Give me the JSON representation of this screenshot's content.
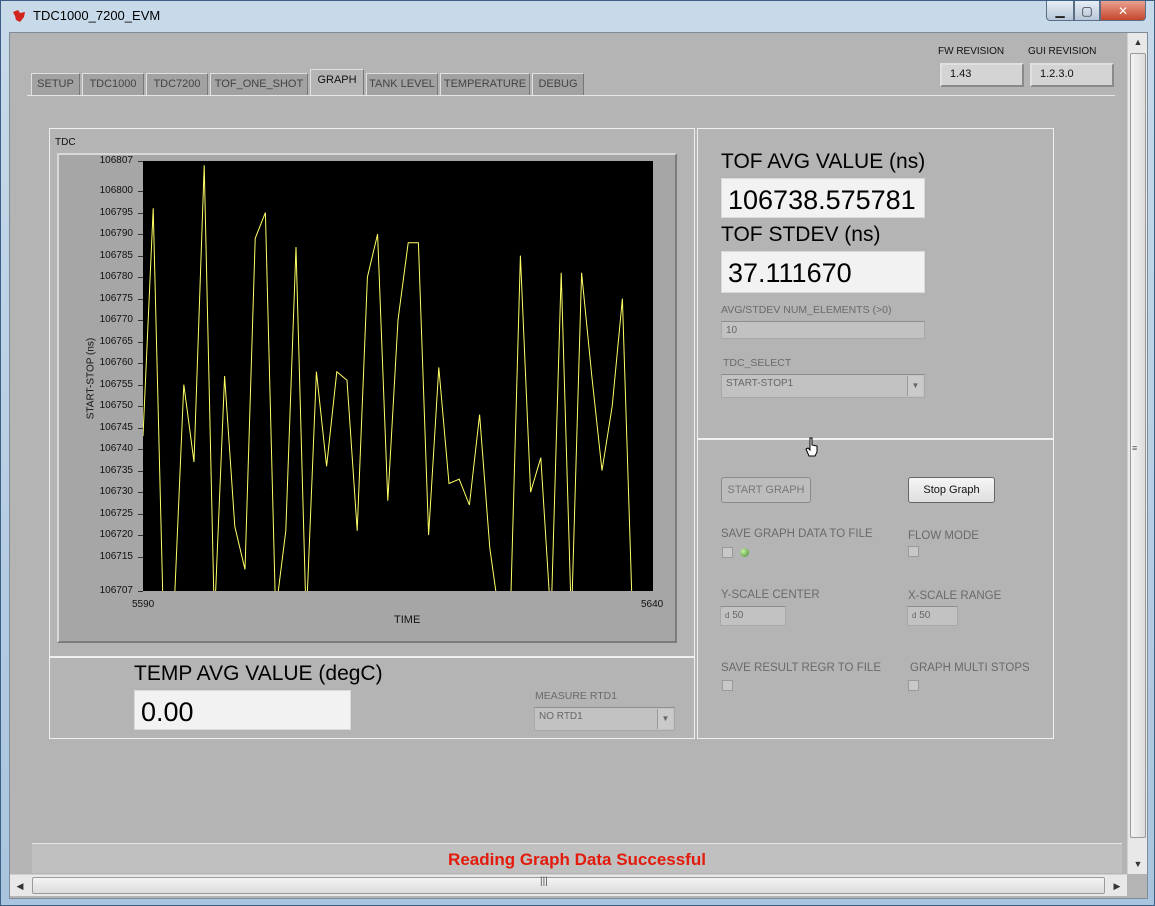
{
  "window": {
    "title": "TDC1000_7200_EVM"
  },
  "revisions": {
    "fw_label": "FW REVISION",
    "fw_value": "1.43",
    "gui_label": "GUI REVISION",
    "gui_value": "1.2.3.0"
  },
  "tabs": [
    {
      "label": "SETUP"
    },
    {
      "label": "TDC1000"
    },
    {
      "label": "TDC7200"
    },
    {
      "label": "TOF_ONE_SHOT"
    },
    {
      "label": "GRAPH"
    },
    {
      "label": "TANK LEVEL"
    },
    {
      "label": "TEMPERATURE"
    },
    {
      "label": "DEBUG"
    }
  ],
  "graph": {
    "title": "TDC",
    "ylabel": "START-STOP (ns)",
    "xlabel": "TIME",
    "x_start": "5590",
    "x_end": "5640"
  },
  "chart_data": {
    "type": "line",
    "title": "TDC",
    "xlabel": "TIME",
    "ylabel": "START-STOP (ns)",
    "xlim": [
      5590,
      5640
    ],
    "ylim": [
      106707,
      106807
    ],
    "yticks": [
      "106807",
      "106800",
      "106795",
      "106790",
      "106785",
      "106780",
      "106775",
      "106770",
      "106765",
      "106760",
      "106755",
      "106750",
      "106745",
      "106740",
      "106735",
      "106730",
      "106725",
      "106720",
      "106715",
      "106707"
    ],
    "line_color": "#ffff66",
    "background": "#000000",
    "series": [
      {
        "x": [
          5590,
          5591,
          5592,
          5593,
          5594,
          5595,
          5596,
          5597,
          5598,
          5599,
          5600,
          5601,
          5602,
          5603,
          5604,
          5605,
          5606,
          5607,
          5608,
          5609,
          5610,
          5611,
          5612,
          5613,
          5614,
          5615,
          5616,
          5617,
          5618,
          5619,
          5620,
          5621,
          5622,
          5623,
          5624,
          5625,
          5626,
          5627,
          5628,
          5629,
          5630,
          5631,
          5632,
          5633,
          5634,
          5635,
          5636,
          5637,
          5638,
          5639,
          5640
        ],
        "y": [
          106743,
          106796,
          106700,
          106700,
          106755,
          106737,
          106806,
          106700,
          106757,
          106722,
          106712,
          106789,
          106795,
          106702,
          106721,
          106787,
          106700,
          106758,
          106736,
          106758,
          106756,
          106721,
          106780,
          106790,
          106728,
          106770,
          106788,
          106788,
          106720,
          106759,
          106732,
          106733,
          106727,
          106748,
          106717,
          106700,
          106700,
          106785,
          106730,
          106738,
          106700,
          106781,
          106700,
          106781,
          106757,
          106735,
          106750,
          106775,
          106700,
          106700,
          106700
        ]
      }
    ]
  },
  "tof": {
    "avg_label": "TOF AVG VALUE (ns)",
    "avg_value": "106738.575781",
    "stdev_label": "TOF STDEV (ns)",
    "stdev_value": "37.111670",
    "num_label": "AVG/STDEV NUM_ELEMENTS (>0)",
    "num_value": "10",
    "select_label": "TDC_SELECT",
    "select_value": "START-STOP1"
  },
  "temp": {
    "avg_label": "TEMP AVG VALUE (degC)",
    "avg_value": "0.00",
    "rtd_label": "MEASURE RTD1",
    "rtd_value": "NO RTD1"
  },
  "controls": {
    "start_graph": "START GRAPH",
    "stop_graph": "Stop Graph",
    "save_graph_label": "SAVE GRAPH DATA TO FILE",
    "flow_mode_label": "FLOW MODE",
    "y_center_label": "Y-SCALE CENTER",
    "y_center_value": "50",
    "y_center_prefix": "d",
    "x_range_label": "X-SCALE RANGE",
    "x_range_value": "50",
    "x_range_prefix": "d",
    "save_regr_label": "SAVE RESULT REGR TO FILE",
    "multi_stops_label": "GRAPH MULTI STOPS"
  },
  "status": {
    "message": "Reading Graph Data Successful"
  }
}
